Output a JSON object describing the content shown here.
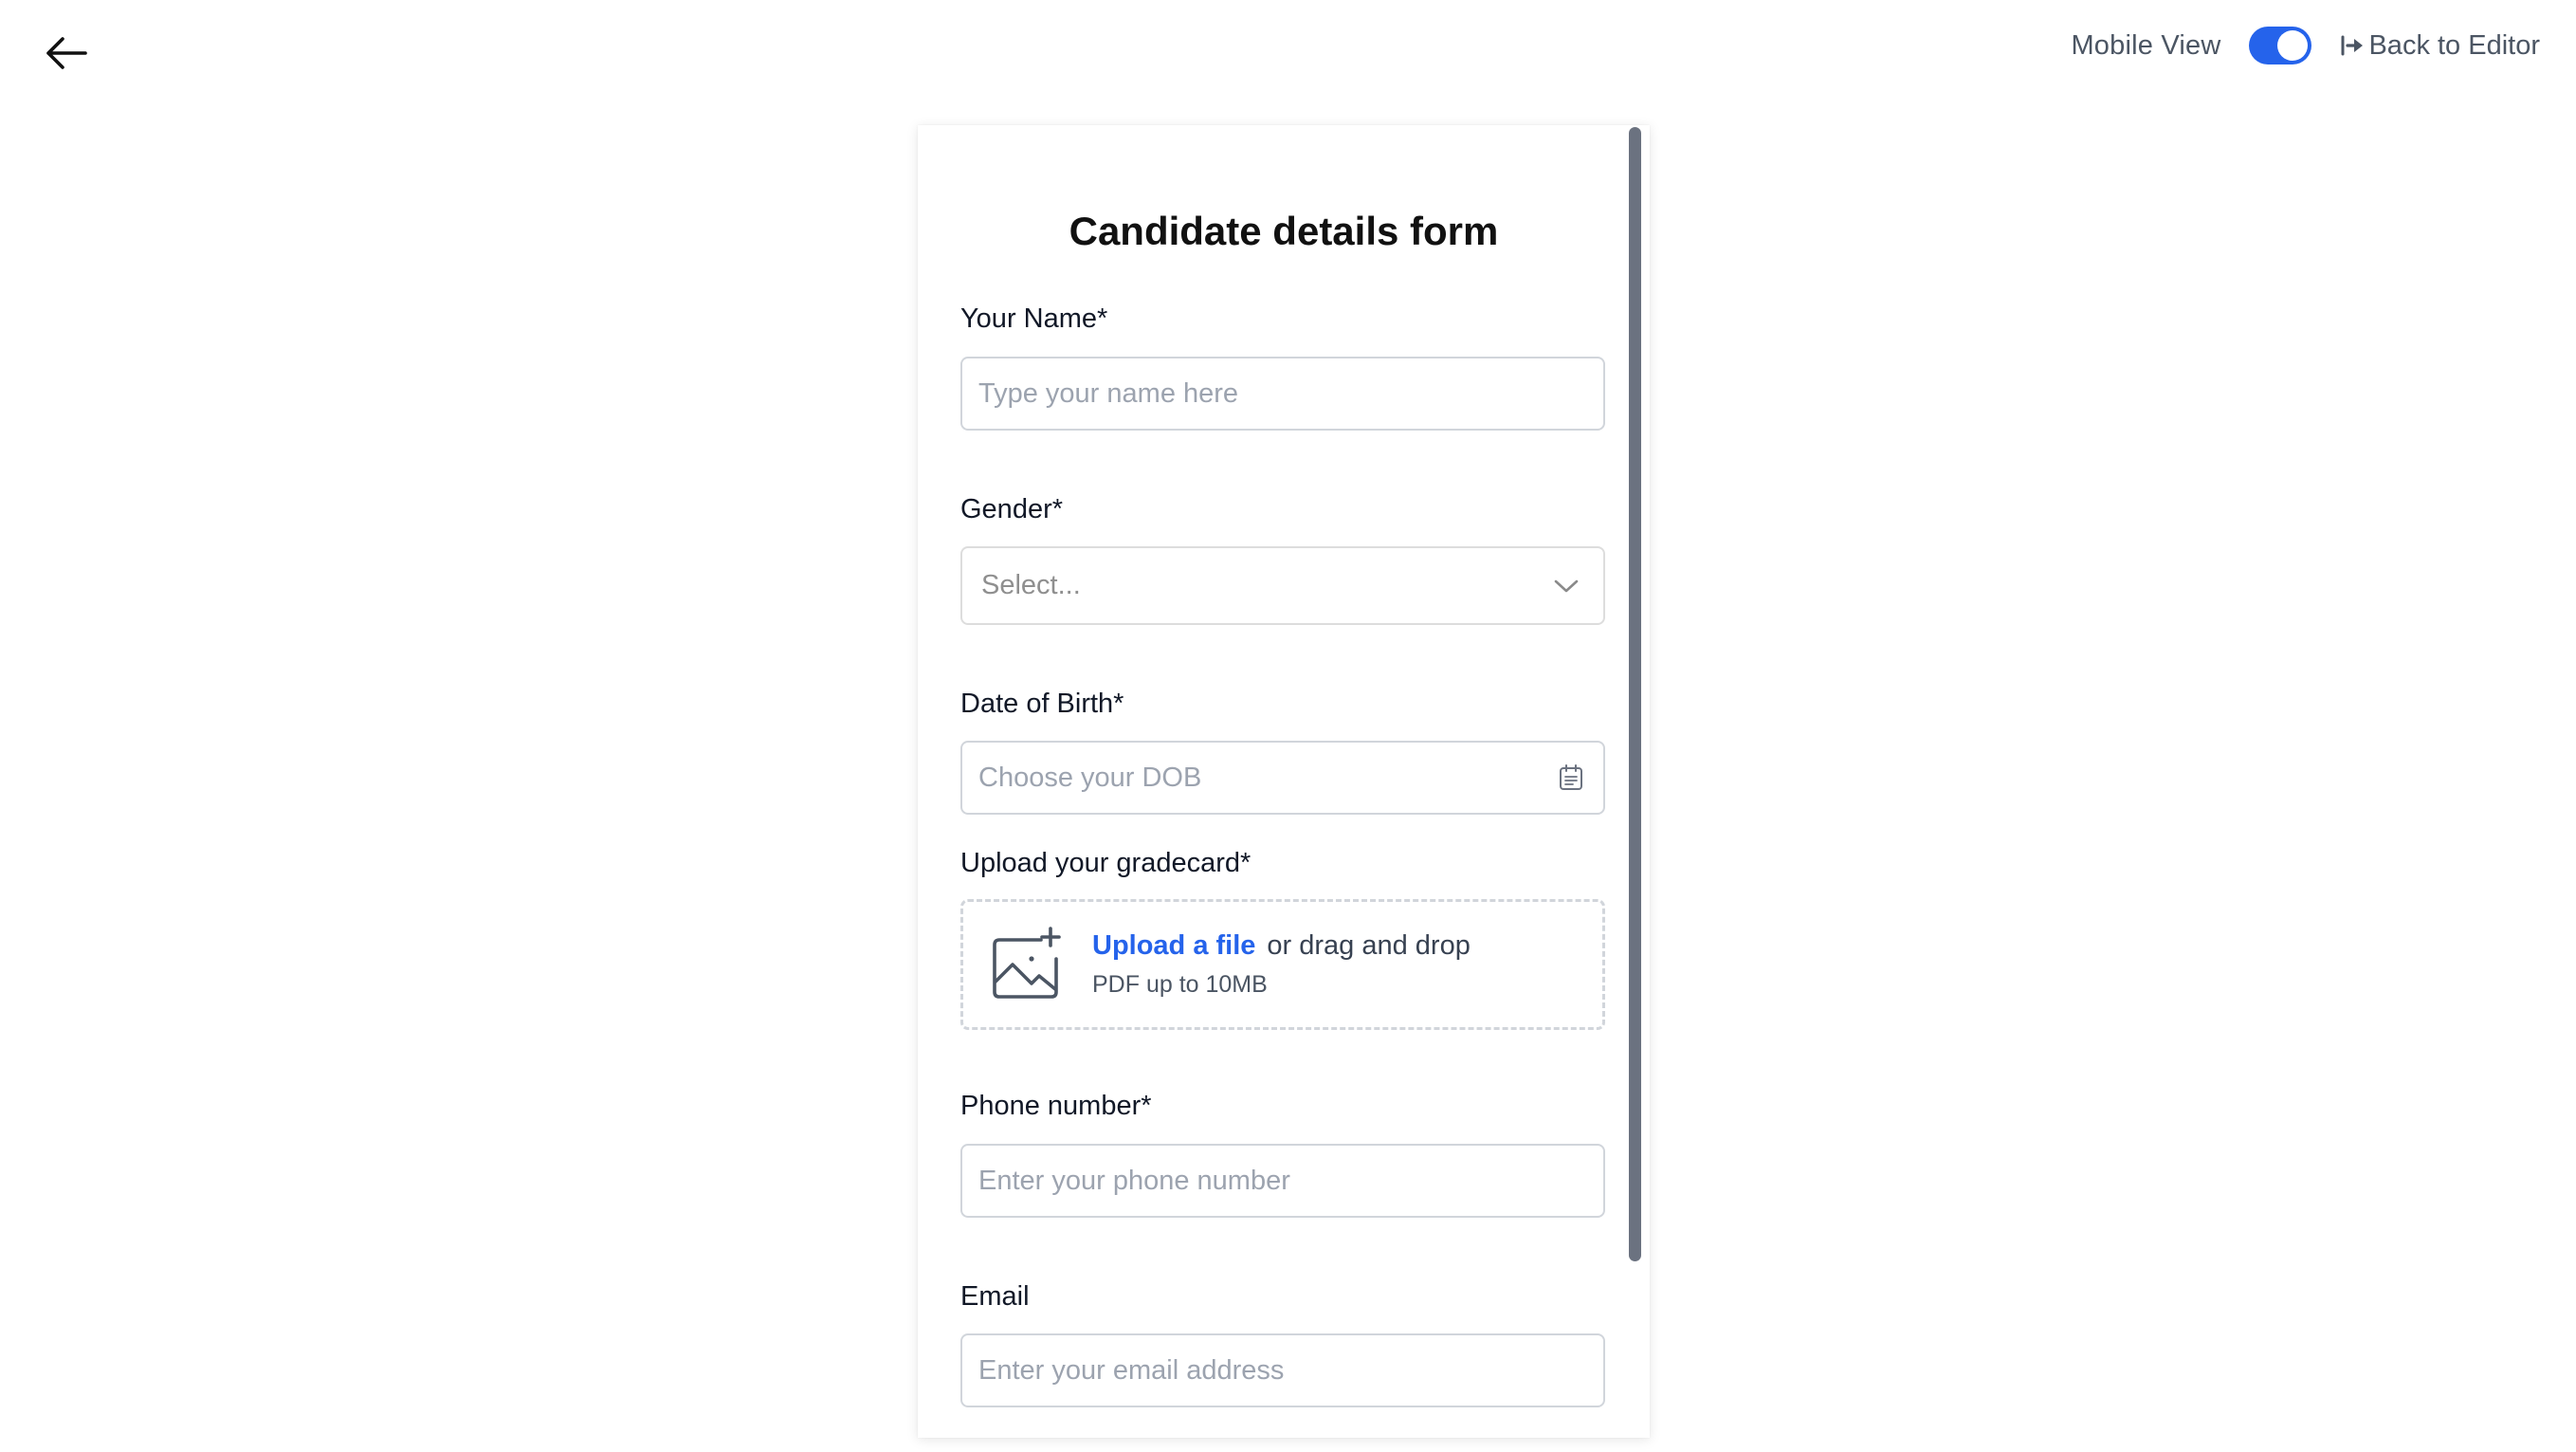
{
  "topbar": {
    "mobile_view_label": "Mobile View",
    "mobile_view_enabled": true,
    "back_to_editor_label": "Back to Editor"
  },
  "form": {
    "title": "Candidate details form",
    "fields": {
      "name": {
        "label": "Your Name*",
        "placeholder": "Type your name here"
      },
      "gender": {
        "label": "Gender*",
        "placeholder": "Select..."
      },
      "dob": {
        "label": "Date of Birth*",
        "placeholder": "Choose your DOB"
      },
      "gradecard": {
        "label": "Upload your gradecard*",
        "upload_link": "Upload a file",
        "upload_suffix": "or drag and drop",
        "hint": "PDF up to 10MB"
      },
      "phone": {
        "label": "Phone number*",
        "placeholder": "Enter your phone number"
      },
      "email": {
        "label": "Email",
        "placeholder": "Enter your email address"
      }
    }
  },
  "colors": {
    "accent": "#2563eb",
    "border": "#d1d5db",
    "placeholder": "#9ca3af",
    "scrollbar": "#6b7280"
  },
  "icons": {
    "back": "arrow-left-icon",
    "back_to_editor": "arrow-right-to-bar-icon",
    "select": "chevron-down-icon",
    "date": "calendar-icon",
    "upload": "image-plus-icon"
  }
}
